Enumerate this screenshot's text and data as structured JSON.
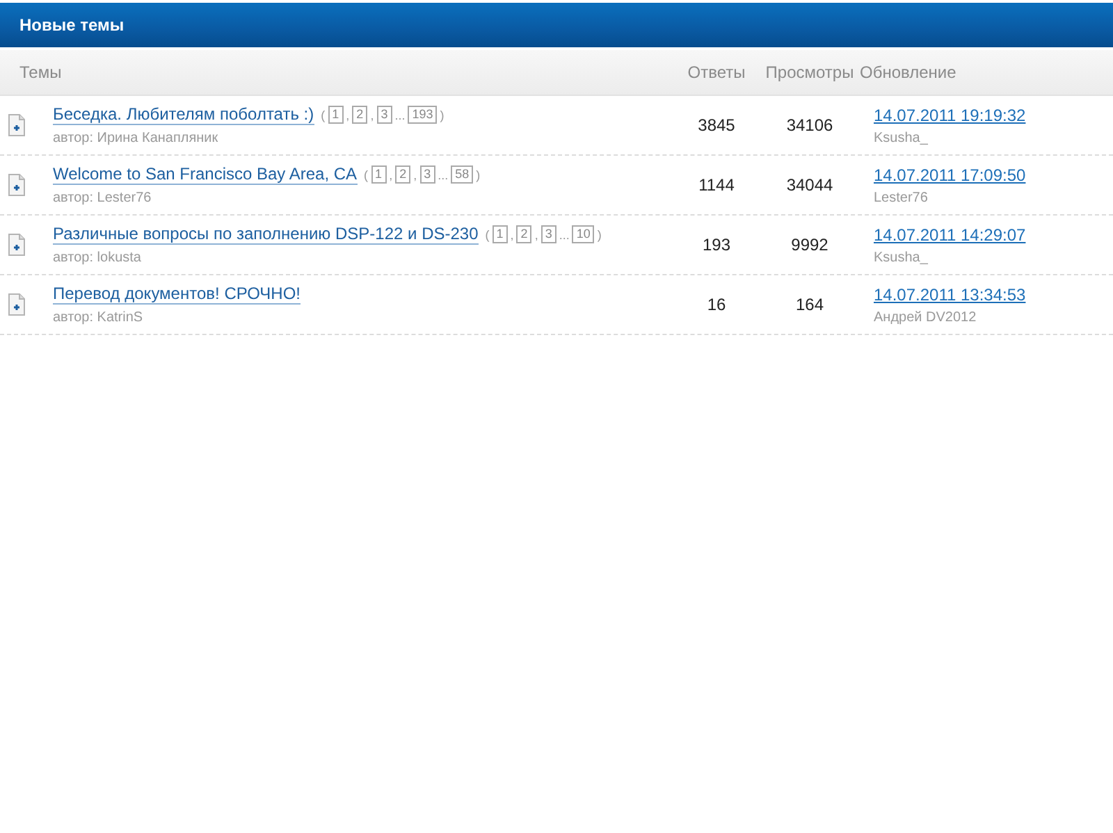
{
  "panel": {
    "title": "Новые темы"
  },
  "columns": [
    "Темы",
    "Ответы",
    "Просмотры",
    "Обновление"
  ],
  "topics": [
    {
      "title": "Беседка. Любителям поболтать :)",
      "author": "автор: Ирина Канапляник",
      "pages": [
        {
          "kind": "punct",
          "text": "("
        },
        {
          "kind": "page",
          "text": "1"
        },
        {
          "kind": "punct",
          "text": ","
        },
        {
          "kind": "page",
          "text": "2"
        },
        {
          "kind": "punct",
          "text": ","
        },
        {
          "kind": "page",
          "text": "3"
        },
        {
          "kind": "punct",
          "text": "..."
        },
        {
          "kind": "page",
          "text": "193"
        },
        {
          "kind": "punct",
          "text": ")"
        }
      ],
      "replies": "3845",
      "views": "34106",
      "updated": "14.07.2011 19:19:32",
      "last_user": "Ksusha_"
    },
    {
      "title": "Welcome to San Francisco Bay Area, CA",
      "author": "автор: Lester76",
      "pages": [
        {
          "kind": "punct",
          "text": "("
        },
        {
          "kind": "page",
          "text": "1"
        },
        {
          "kind": "punct",
          "text": ","
        },
        {
          "kind": "page",
          "text": "2"
        },
        {
          "kind": "punct",
          "text": ","
        },
        {
          "kind": "page",
          "text": "3"
        },
        {
          "kind": "punct",
          "text": "..."
        },
        {
          "kind": "page",
          "text": "58"
        },
        {
          "kind": "punct",
          "text": ")"
        }
      ],
      "replies": "1144",
      "views": "34044",
      "updated": "14.07.2011 17:09:50",
      "last_user": "Lester76"
    },
    {
      "title": "Различные вопросы по заполнению DSP-122 и DS-230",
      "author": "автор: lokusta",
      "pages": [
        {
          "kind": "punct",
          "text": "("
        },
        {
          "kind": "page",
          "text": "1"
        },
        {
          "kind": "punct",
          "text": ","
        },
        {
          "kind": "page",
          "text": "2"
        },
        {
          "kind": "punct",
          "text": ","
        },
        {
          "kind": "page",
          "text": "3"
        },
        {
          "kind": "punct",
          "text": "..."
        },
        {
          "kind": "page",
          "text": "10"
        },
        {
          "kind": "punct",
          "text": ")"
        }
      ],
      "replies": "193",
      "views": "9992",
      "updated": "14.07.2011 14:29:07",
      "last_user": "Ksusha_"
    },
    {
      "title": "Перевод документов! СРОЧНО!",
      "author": "автор: KatrinS",
      "replies": "16",
      "views": "164",
      "updated": "14.07.2011 13:34:53",
      "last_user": "Андрей DV2012"
    }
  ]
}
